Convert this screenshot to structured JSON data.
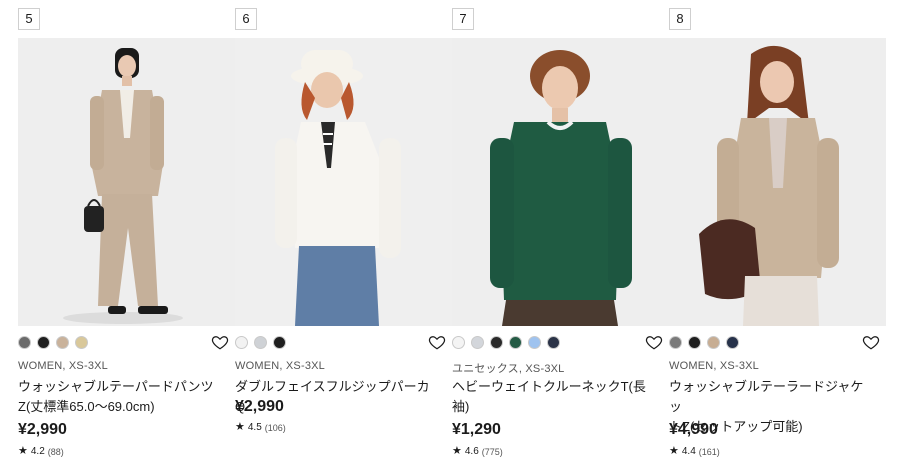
{
  "products": [
    {
      "rank": "5",
      "swatches": [
        "#6b6b6b",
        "#1f1f1f",
        "#c9b29b",
        "#d9c89a"
      ],
      "meta": "WOMEN, XS-3XL",
      "name_line1": "ウォッシャブルテーパードパンツ",
      "name_line2": "Z(丈標準65.0～69.0cm)",
      "price": "¥2,990",
      "rating": "4.2",
      "reviews": "(88)"
    },
    {
      "rank": "6",
      "swatches": [
        "#f2f2f2",
        "#cfd2d6",
        "#1f1f1f"
      ],
      "meta": "WOMEN, XS-3XL",
      "name_line1": "ダブルフェイスフルジップパーカQ",
      "name_line2": "",
      "price": "¥2,990",
      "rating": "4.5",
      "reviews": "(106)"
    },
    {
      "rank": "7",
      "swatches": [
        "#f4f4f4",
        "#d3d6db",
        "#2a2a2a",
        "#245b45",
        "#9fc3ef",
        "#2b3347"
      ],
      "meta": "ユニセックス, XS-3XL",
      "name_line1": "ヘビーウェイトクルーネックT(長",
      "name_line2": "袖)",
      "price": "¥1,290",
      "rating": "4.6",
      "reviews": "(775)"
    },
    {
      "rank": "8",
      "swatches": [
        "#7a7a7a",
        "#1f1f1f",
        "#c7ad93",
        "#27324a"
      ],
      "meta": "WOMEN, XS-3XL",
      "name_line1": "ウォッシャブルテーラードジャケッ",
      "name_line2": "トZ(セットアップ可能)",
      "price": "¥4,990",
      "rating": "4.4",
      "reviews": "(161)"
    }
  ]
}
